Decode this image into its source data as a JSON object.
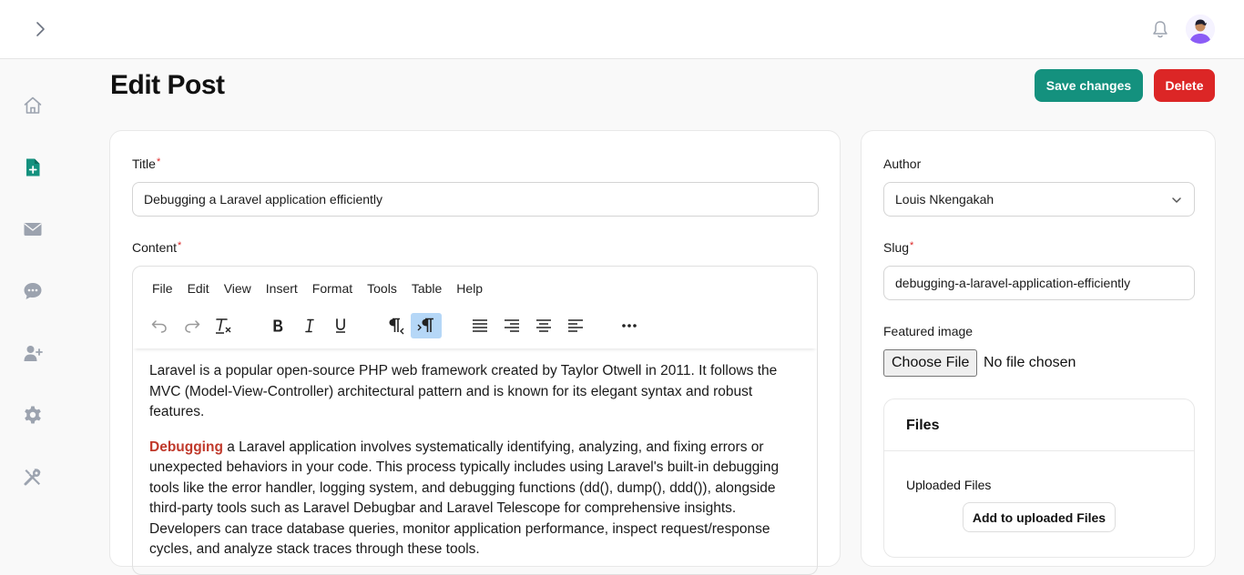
{
  "header": {
    "expand_icon": "chevron-right-icon",
    "notification_icon": "bell-icon",
    "avatar": "user-avatar"
  },
  "sidebar": {
    "items": [
      {
        "icon": "home-icon",
        "active": false
      },
      {
        "icon": "document-plus-icon",
        "active": true
      },
      {
        "icon": "mail-icon",
        "active": false
      },
      {
        "icon": "chat-icon",
        "active": false
      },
      {
        "icon": "user-plus-icon",
        "active": false
      },
      {
        "icon": "gear-icon",
        "active": false
      },
      {
        "icon": "tools-icon",
        "active": false
      }
    ],
    "active_color": "#14917e",
    "icon_color": "#9ca3af"
  },
  "page": {
    "title": "Edit Post",
    "save_label": "Save changes",
    "delete_label": "Delete",
    "save_color": "#14917e",
    "delete_color": "#dc2626"
  },
  "form": {
    "title_label": "Title",
    "title_value": "Debugging a Laravel application efficiently",
    "content_label": "Content",
    "required_mark": "*"
  },
  "editor": {
    "menu": [
      "File",
      "Edit",
      "View",
      "Insert",
      "Format",
      "Tools",
      "Table",
      "Help"
    ],
    "toolbar": [
      {
        "icon": "undo-icon"
      },
      {
        "icon": "redo-icon"
      },
      {
        "icon": "clear-formatting-icon"
      },
      {
        "icon": "bold-icon"
      },
      {
        "icon": "italic-icon"
      },
      {
        "icon": "underline-icon"
      },
      {
        "icon": "rtl-paragraph-icon"
      },
      {
        "icon": "ltr-paragraph-icon",
        "active": true
      },
      {
        "icon": "align-justify-icon"
      },
      {
        "icon": "align-right-icon"
      },
      {
        "icon": "align-center-icon"
      },
      {
        "icon": "align-left-icon"
      },
      {
        "icon": "more-icon"
      }
    ],
    "paragraph1": " Laravel is a popular open-source PHP web framework created by Taylor Otwell in 2011. It follows the MVC (Model-View-Controller) architectural pattern and is known for its elegant syntax and robust features.",
    "paragraph2_highlight": "Debugging",
    "paragraph2_rest": " a Laravel application involves systematically identifying, analyzing, and fixing errors or unexpected behaviors in your code. This process typically includes using Laravel's built-in debugging tools like the error handler, logging system, and debugging functions (dd(), dump(), ddd()), alongside third-party tools such as Laravel Debugbar and Laravel Telescope for comprehensive insights. Developers can trace database queries, monitor application performance, inspect request/response cycles, and analyze stack traces through these tools."
  },
  "side": {
    "author_label": "Author",
    "author_value": "Louis Nkengakah",
    "slug_label": "Slug",
    "slug_value": "debugging-a-laravel-application-efficiently",
    "featured_label": "Featured image",
    "choose_file_label": "Choose File",
    "no_file_text": "No file chosen",
    "files_title": "Files",
    "uploaded_label": "Uploaded Files",
    "add_uploaded_label": "Add to uploaded Files"
  }
}
